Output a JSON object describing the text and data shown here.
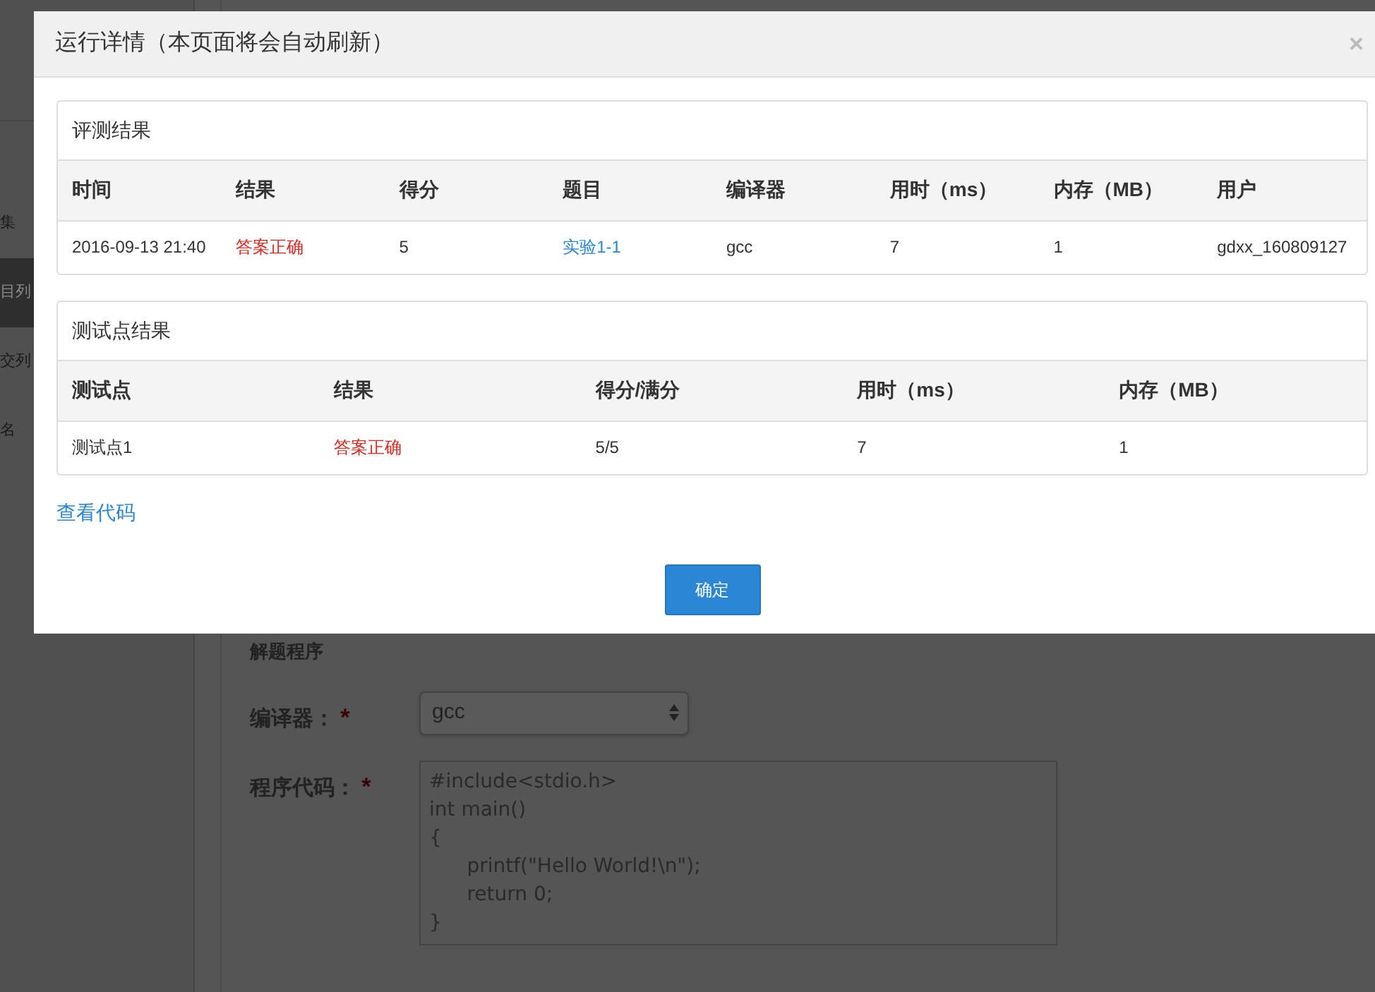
{
  "background": {
    "sidebar": {
      "items": [
        {
          "label": "集",
          "selected": false
        },
        {
          "label": "目列",
          "selected": true
        },
        {
          "label": "交列",
          "selected": false
        },
        {
          "label": "名",
          "selected": false
        }
      ]
    },
    "form": {
      "section_title": "解题程序",
      "fields": [
        {
          "kind": "select",
          "label": "编译器：",
          "required_mark": "*",
          "value": "gcc"
        },
        {
          "kind": "textarea",
          "label": "程序代码：",
          "required_mark": "*",
          "value": "#include<stdio.h>\nint main()\n{\n      printf(\"Hello World!\\n\");\n      return 0;\n}"
        }
      ]
    }
  },
  "modal": {
    "title": "运行详情（本页面将会自动刷新）",
    "close": "×",
    "panels": [
      {
        "title": "评测结果",
        "columns": [
          "时间",
          "结果",
          "得分",
          "题目",
          "编译器",
          "用时（ms）",
          "内存（MB）",
          "用户"
        ],
        "rows": [
          [
            {
              "kind": "plain",
              "text": "2016-09-13 21:40"
            },
            {
              "kind": "status",
              "text": "答案正确"
            },
            {
              "kind": "plain",
              "text": "5"
            },
            {
              "kind": "link",
              "text": "实验1-1"
            },
            {
              "kind": "plain",
              "text": "gcc"
            },
            {
              "kind": "plain",
              "text": "7"
            },
            {
              "kind": "plain",
              "text": "1"
            },
            {
              "kind": "plain",
              "text": "gdxx_160809127"
            }
          ]
        ]
      },
      {
        "title": "测试点结果",
        "columns": [
          "测试点",
          "结果",
          "得分/满分",
          "用时（ms）",
          "内存（MB）"
        ],
        "rows": [
          [
            {
              "kind": "plain",
              "text": "测试点1"
            },
            {
              "kind": "status",
              "text": "答案正确"
            },
            {
              "kind": "plain",
              "text": "5/5"
            },
            {
              "kind": "plain",
              "text": "7"
            },
            {
              "kind": "plain",
              "text": "1"
            }
          ]
        ]
      }
    ],
    "link": "查看代码",
    "ok_button": "确定"
  }
}
